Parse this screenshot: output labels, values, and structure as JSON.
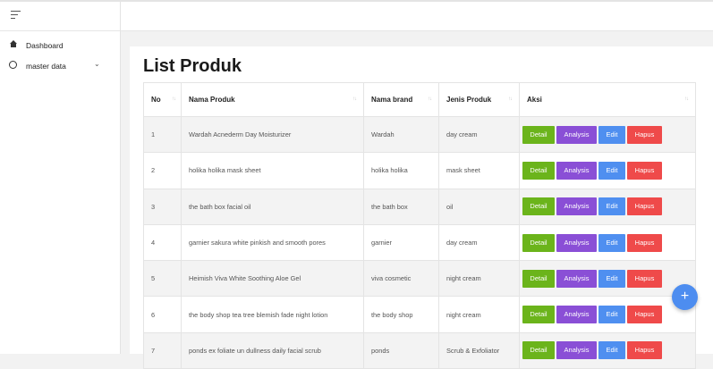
{
  "sidebar": {
    "items": [
      {
        "label": "Dashboard",
        "icon": "home-icon"
      },
      {
        "label": "master data",
        "icon": "circle-icon",
        "chevron": "⌄"
      }
    ]
  },
  "main": {
    "title": "List Produk",
    "columns": [
      "No",
      "Nama Produk",
      "Nama brand",
      "Jenis Produk",
      "Aksi"
    ],
    "actions": {
      "detail": "Detail",
      "analysis": "Analysis",
      "edit": "Edit",
      "hapus": "Hapus"
    },
    "rows": [
      {
        "no": "1",
        "nama": "Wardah Acnederm Day Moisturizer",
        "brand": "Wardah",
        "jenis": "day cream"
      },
      {
        "no": "2",
        "nama": "holika holika mask sheet",
        "brand": "holika holika",
        "jenis": "mask sheet"
      },
      {
        "no": "3",
        "nama": "the bath box facial oil",
        "brand": "the bath box",
        "jenis": "oil"
      },
      {
        "no": "4",
        "nama": "garnier sakura white pinkish and smooth pores",
        "brand": "garnier",
        "jenis": "day cream"
      },
      {
        "no": "5",
        "nama": "Heimish Viva White Soothing Aloe Gel",
        "brand": "viva cosmetic",
        "jenis": "night cream"
      },
      {
        "no": "6",
        "nama": "the body shop tea tree blemish fade night lotion",
        "brand": "the body shop",
        "jenis": "night cream"
      },
      {
        "no": "7",
        "nama": "ponds ex foliate un dullness daily facial scrub",
        "brand": "ponds",
        "jenis": "Scrub & Exfoliator"
      }
    ]
  },
  "fab": {
    "label": "+"
  },
  "colors": {
    "detail": "#6bb41b",
    "analysis": "#8a4fd6",
    "edit": "#4f8ff0",
    "hapus": "#ef4a4a",
    "fab": "#4d8df0"
  }
}
